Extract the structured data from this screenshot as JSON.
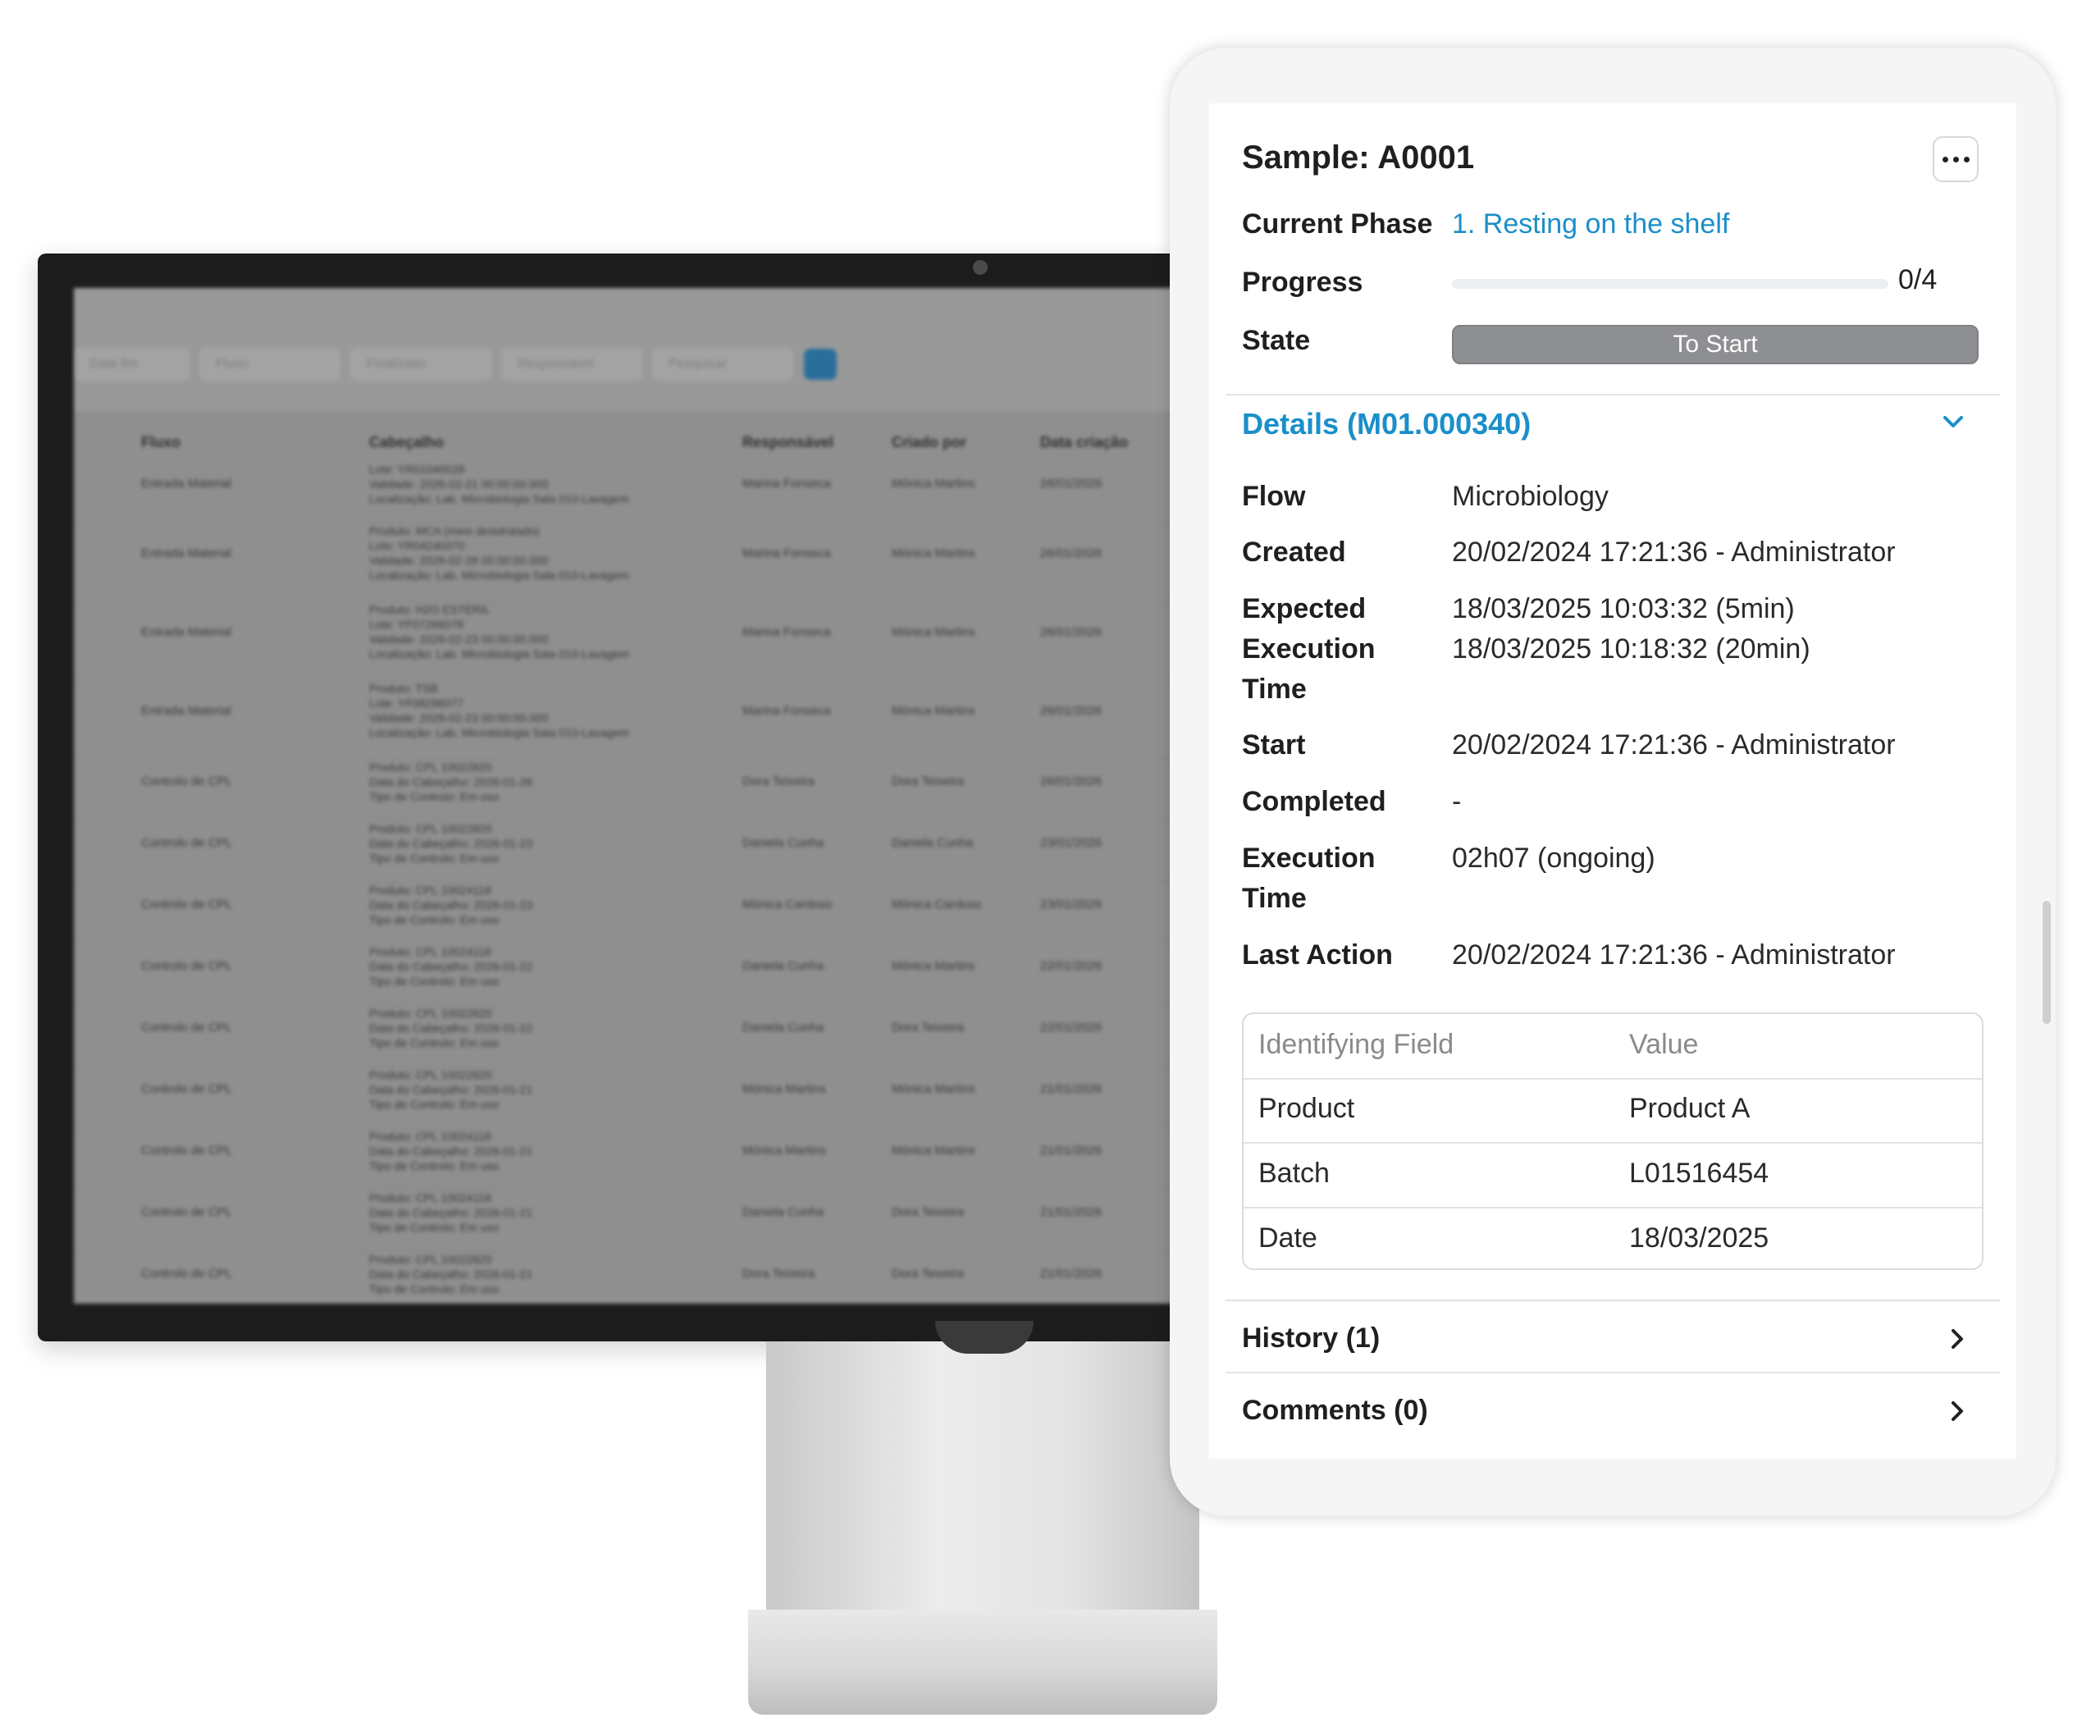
{
  "monitor": {
    "filters": [
      "Data fim",
      "Fluxo",
      "Finalizado",
      "Responsável",
      "Pesquisar"
    ],
    "columns": [
      "Fluxo",
      "Cabeçalho",
      "Responsável",
      "Criado por",
      "Data criação"
    ],
    "rows": [
      {
        "flow": "Entrada Material",
        "head": [
          "Lote: YR01040028",
          "Validade: 2026-02-21 00:00:00.000",
          "Localização: Lab. Microbiologia Sala 010-Lavagem"
        ],
        "resp": "Marina Fonseca",
        "by": "Mónica Martins",
        "date": "26/01/2026"
      },
      {
        "flow": "Entrada Material",
        "head": [
          "Produto: MCA (meio desidratado)",
          "Lote: YR04240370",
          "Validade: 2026-02-28 00:00:00.000",
          "Localização: Lab. Microbiologia Sala 010-Lavagem"
        ],
        "resp": "Marina Fonseca",
        "by": "Mónica Martins",
        "date": "26/01/2026"
      },
      {
        "flow": "Entrada Material",
        "head": [
          "Produto: H2O ESTÉRIL",
          "Lote: YF07266078",
          "Validade: 2026-02-23 00:00:00.000",
          "Localização: Lab. Microbiologia Sala 010-Lavagem"
        ],
        "resp": "Marina Fonseca",
        "by": "Mónica Martins",
        "date": "26/01/2026"
      },
      {
        "flow": "Entrada Material",
        "head": [
          "Produto: TSB",
          "Lote: YF08296077",
          "Validade: 2026-02-23 00:00:00.000",
          "Localização: Lab. Microbiologia Sala 010-Lavagem"
        ],
        "resp": "Marina Fonseca",
        "by": "Mónica Martins",
        "date": "26/01/2026"
      },
      {
        "flow": "Controlo de CPL",
        "head": [
          "Produto: CPL 10022820",
          "Data do Cabeçalho: 2026-01-26",
          "Tipo de Controlo: Em uso"
        ],
        "resp": "Dora Teixeira",
        "by": "Dora Teixeira",
        "date": "26/01/2026"
      },
      {
        "flow": "Controlo de CPL",
        "head": [
          "Produto: CPL 10022820",
          "Data do Cabeçalho: 2026-01-23",
          "Tipo de Controlo: Em uso"
        ],
        "resp": "Daniela Cunha",
        "by": "Daniela Cunha",
        "date": "23/01/2026"
      },
      {
        "flow": "Controlo de CPL",
        "head": [
          "Produto: CPL 10024118",
          "Data do Cabeçalho: 2026-01-23",
          "Tipo de Controlo: Em uso"
        ],
        "resp": "Mónica Cardoso",
        "by": "Mónica Cardoso",
        "date": "23/01/2026"
      },
      {
        "flow": "Controlo de CPL",
        "head": [
          "Produto: CPL 10024118",
          "Data do Cabeçalho: 2026-01-22",
          "Tipo de Controlo: Em uso"
        ],
        "resp": "Daniela Cunha",
        "by": "Mónica Martins",
        "date": "22/01/2026"
      },
      {
        "flow": "Controlo de CPL",
        "head": [
          "Produto: CPL 10022820",
          "Data do Cabeçalho: 2026-01-22",
          "Tipo de Controlo: Em uso"
        ],
        "resp": "Daniela Cunha",
        "by": "Dora Teixeira",
        "date": "22/01/2026"
      },
      {
        "flow": "Controlo de CPL",
        "head": [
          "Produto: CPL 10022820",
          "Data do Cabeçalho: 2026-01-21",
          "Tipo de Controlo: Em uso"
        ],
        "resp": "Mónica Martins",
        "by": "Mónica Martins",
        "date": "21/01/2026"
      },
      {
        "flow": "Controlo de CPL",
        "head": [
          "Produto: CPL 10024118",
          "Data do Cabeçalho: 2026-01-21",
          "Tipo de Controlo: Em uso"
        ],
        "resp": "Mónica Martins",
        "by": "Mónica Martins",
        "date": "21/01/2026"
      },
      {
        "flow": "Controlo de CPL",
        "head": [
          "Produto: CPL 10024118",
          "Data do Cabeçalho: 2026-01-21",
          "Tipo de Controlo: Em uso"
        ],
        "resp": "Daniela Cunha",
        "by": "Dora Teixeira",
        "date": "21/01/2026"
      },
      {
        "flow": "Controlo de CPL",
        "head": [
          "Produto: CPL 10022820",
          "Data do Cabeçalho: 2026-01-21",
          "Tipo de Controlo: Em uso"
        ],
        "resp": "Dora Teixeira",
        "by": "Dora Teixeira",
        "date": "21/01/2026"
      }
    ]
  },
  "panel": {
    "title": "Sample: A0001",
    "more_icon": "ellipsis-icon",
    "current_phase_label": "Current Phase",
    "current_phase_value": "1. Resting on the shelf",
    "progress_label": "Progress",
    "progress_text": "0/4",
    "progress_fraction": 0,
    "state_label": "State",
    "state_value": "To Start",
    "details_title": "Details (M01.000340)",
    "details": [
      {
        "label": "Flow",
        "value": "Microbiology"
      },
      {
        "label": "Created",
        "value": "20/02/2024 17:21:36 - Administrator"
      },
      {
        "label": "Expected Execution Time",
        "value": "18/03/2025 10:03:32 (5min)\n18/03/2025 10:18:32 (20min)"
      },
      {
        "label": "Start",
        "value": "20/02/2024 17:21:36 - Administrator"
      },
      {
        "label": "Completed",
        "value": "-"
      },
      {
        "label": "Execution Time",
        "value": "02h07 (ongoing)"
      },
      {
        "label": "Last Action",
        "value": "20/02/2024 17:21:36 - Administrator"
      }
    ],
    "id_table": {
      "headers": [
        "Identifying Field",
        "Value"
      ],
      "rows": [
        [
          "Product",
          "Product A"
        ],
        [
          "Batch",
          "L01516454"
        ],
        [
          "Date",
          "18/03/2025"
        ]
      ]
    },
    "history_label": "History (1)",
    "comments_label": "Comments (0)",
    "colors": {
      "accent": "#1a8fc9",
      "state_pill": "#8e8f92"
    }
  }
}
